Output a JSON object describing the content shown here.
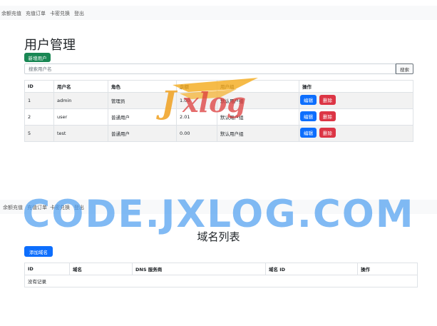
{
  "nav_top": {
    "items": [
      "余额充值",
      "充值订单",
      "卡密兑换",
      "登出"
    ]
  },
  "users_page": {
    "title": "用户管理",
    "add_button": "新增用户",
    "search_placeholder": "搜索用户名",
    "search_button": "搜索",
    "columns": [
      "ID",
      "用户名",
      "角色",
      "余额",
      "用户组",
      "操作"
    ],
    "rows": [
      {
        "id": "1",
        "username": "admin",
        "role": "管理员",
        "balance": "1.00",
        "group": "默认用户组"
      },
      {
        "id": "2",
        "username": "user",
        "role": "普通用户",
        "balance": "2.01",
        "group": "默认用户组"
      },
      {
        "id": "5",
        "username": "test",
        "role": "普通用户",
        "balance": "0.00",
        "group": "默认用户组"
      }
    ],
    "edit_label": "编辑",
    "delete_label": "删除"
  },
  "nav_bottom": {
    "items": [
      "余额充值",
      "充值订单",
      "卡密兑换",
      "登出"
    ]
  },
  "domains_page": {
    "title": "域名列表",
    "add_button": "添加域名",
    "columns": [
      "ID",
      "域名",
      "DNS 服务商",
      "域名 ID",
      "操作"
    ],
    "empty_text": "没有记录"
  },
  "watermark": {
    "logo_text": "Jxlog",
    "banner_text": "CODE.JXLOG.COM"
  },
  "colors": {
    "primary": "#0d6efd",
    "danger": "#dc3545",
    "success": "#198754",
    "navbar": "#f8f9fa"
  }
}
